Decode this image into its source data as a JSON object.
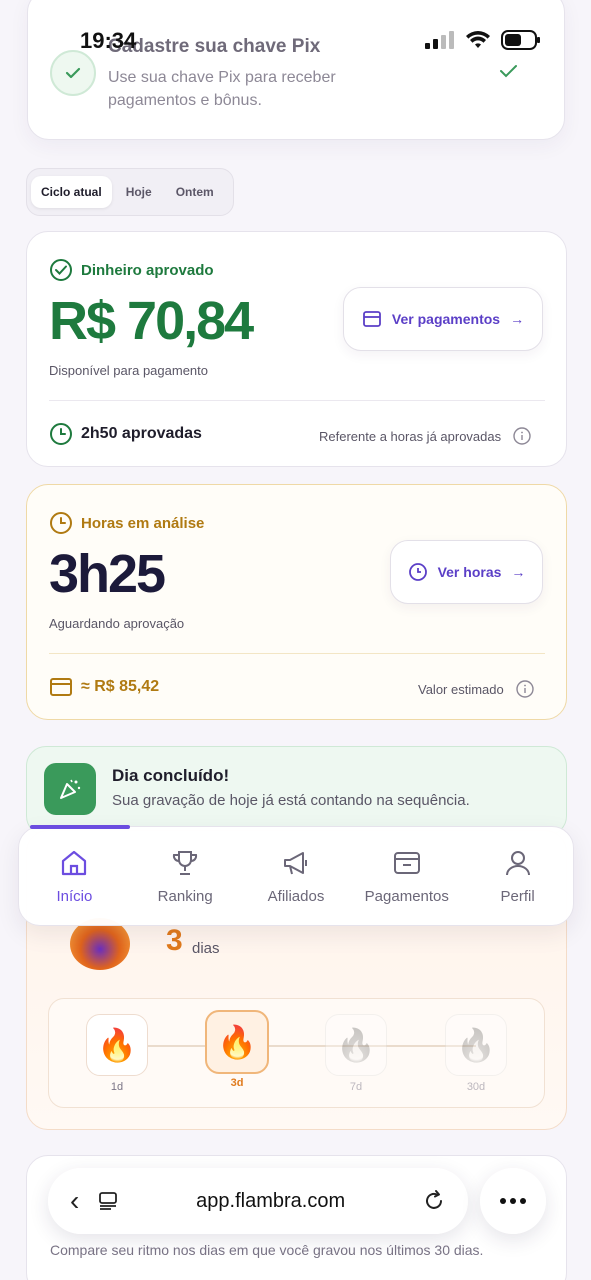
{
  "status_bar": {
    "time": "19:34"
  },
  "pix_card": {
    "title": "Cadastre sua chave Pix",
    "subtitle": "Use sua chave Pix para receber pagamentos e bônus."
  },
  "tabs": [
    {
      "label": "Ciclo atual",
      "active": true
    },
    {
      "label": "Hoje",
      "active": false
    },
    {
      "label": "Ontem",
      "active": false
    }
  ],
  "approved": {
    "label": "Dinheiro aprovado",
    "amount": "R$ 70,84",
    "sub": "Disponível para pagamento",
    "button": "Ver pagamentos",
    "hours": "2h50 aprovadas",
    "hours_note": "Referente a horas já aprovadas",
    "color": "#1e7a3e"
  },
  "hours_review": {
    "label": "Horas em análise",
    "amount": "3h25",
    "sub": "Aguardando aprovação",
    "button": "Ver horas",
    "estimate": "≈ R$ 85,42",
    "estimate_note": "Valor estimado",
    "color": "#b07a12"
  },
  "day_done": {
    "title": "Dia concluído!",
    "subtitle": "Sua gravação de hoje já está contando na sequência."
  },
  "streak": {
    "count": "3",
    "unit": "dias",
    "milestones": [
      {
        "label": "1d",
        "state": "done"
      },
      {
        "label": "3d",
        "state": "current"
      },
      {
        "label": "7d",
        "state": "locked"
      },
      {
        "label": "30d",
        "state": "locked"
      }
    ]
  },
  "nav": {
    "items": [
      {
        "label": "Início",
        "icon": "home-icon",
        "active": true
      },
      {
        "label": "Ranking",
        "icon": "trophy-icon",
        "active": false
      },
      {
        "label": "Afiliados",
        "icon": "megaphone-icon",
        "active": false
      },
      {
        "label": "Pagamentos",
        "icon": "wallet-icon",
        "active": false
      },
      {
        "label": "Perfil",
        "icon": "user-icon",
        "active": false
      }
    ],
    "accent": "#6c4de0"
  },
  "compare": {
    "text": "Compare seu ritmo nos dias em que você gravou nos últimos 30 dias."
  },
  "browser": {
    "url": "app.flambra.com"
  }
}
